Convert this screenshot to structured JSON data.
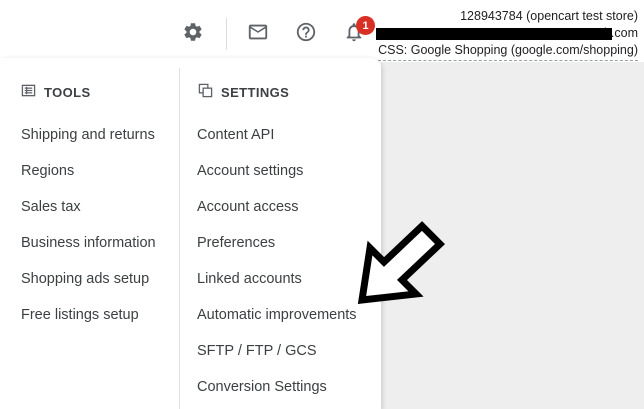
{
  "header": {
    "notification_count": "1",
    "account_line1": "128943784 (opencart test store)",
    "account_line2_suffix": "h.com",
    "account_line3": "CSS: Google Shopping (google.com/shopping)",
    "icons": [
      "gear-icon",
      "mail-icon",
      "help-icon",
      "bell-icon"
    ]
  },
  "tools": {
    "heading": "TOOLS",
    "items": [
      "Shipping and returns",
      "Regions",
      "Sales tax",
      "Business information",
      "Shopping ads setup",
      "Free listings setup"
    ]
  },
  "settings": {
    "heading": "SETTINGS",
    "items": [
      "Content API",
      "Account settings",
      "Account access",
      "Preferences",
      "Linked accounts",
      "Automatic improvements",
      "SFTP / FTP / GCS",
      "Conversion Settings"
    ]
  },
  "colors": {
    "badge": "#d93025",
    "text": "#3c4043",
    "overlay": "#eeeeee"
  }
}
